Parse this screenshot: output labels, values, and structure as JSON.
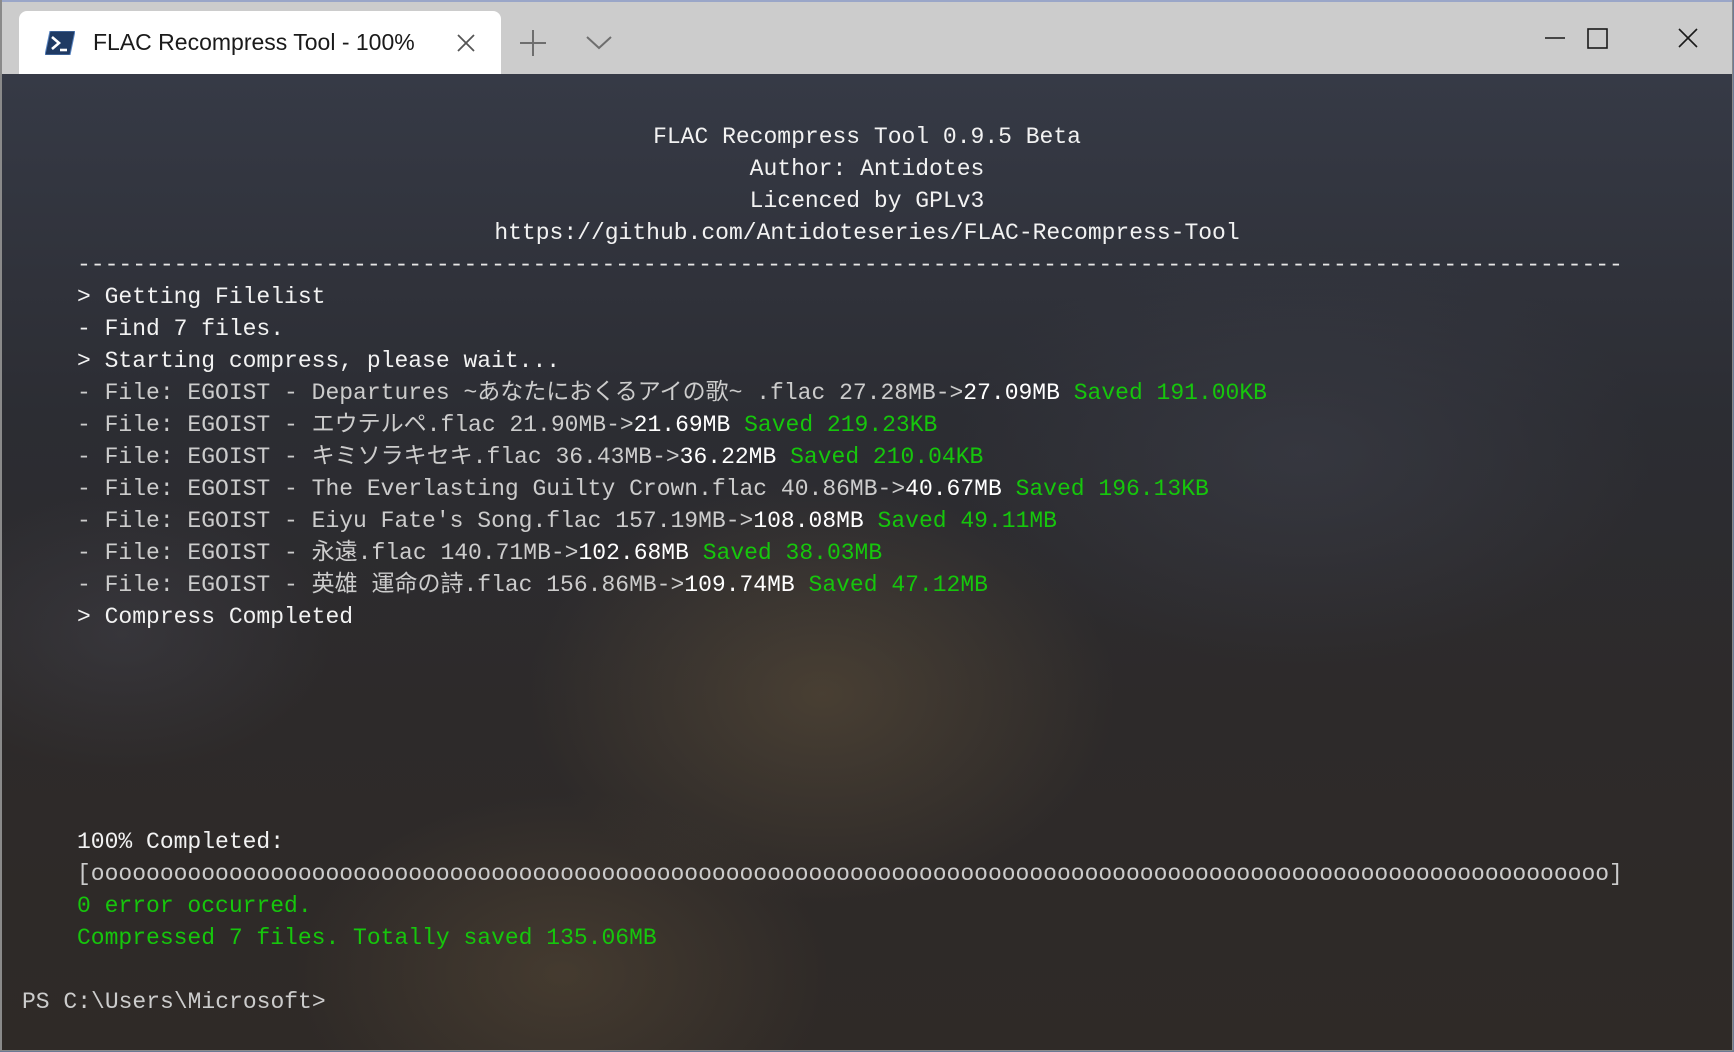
{
  "window": {
    "tab_title": "FLAC Recompress Tool - 100%",
    "tab_icon": "powershell-icon",
    "buttons": {
      "close_tab": "close-icon",
      "new_tab": "plus-icon",
      "dropdown": "chevron-down-icon",
      "minimize": "minimize-icon",
      "maximize": "maximize-icon",
      "close_window": "close-icon"
    }
  },
  "colors": {
    "text": "#cccccc",
    "bright_text": "#f2f2f2",
    "success_green": "#16c60c",
    "tab_bar": "#cccccc"
  },
  "header": {
    "title": "FLAC Recompress Tool 0.9.5 Beta",
    "author": "Author: Antidotes",
    "licence": "Licenced by GPLv3",
    "url": "https://github.com/Antidoteseries/FLAC-Recompress-Tool",
    "separator": "----------------------------------------------------------------------------------------------------------------"
  },
  "status": {
    "getting_filelist": "> Getting Filelist",
    "found_files": "- Find 7 files.",
    "starting": "> Starting compress, please wait...",
    "completed": "> Compress Completed"
  },
  "files": [
    {
      "prefix": "- File: EGOIST - Departures ~あなたにおくるアイの歌~ .flac 27.28MB->",
      "new_size": "27.09MB",
      "saved": "Saved 191.00KB"
    },
    {
      "prefix": "- File: EGOIST - エウテルペ.flac 21.90MB->",
      "new_size": "21.69MB",
      "saved": "Saved 219.23KB"
    },
    {
      "prefix": "- File: EGOIST - キミソラキセキ.flac 36.43MB->",
      "new_size": "36.22MB",
      "saved": "Saved 210.04KB"
    },
    {
      "prefix": "- File: EGOIST - The Everlasting Guilty Crown.flac 40.86MB->",
      "new_size": "40.67MB",
      "saved": "Saved 196.13KB"
    },
    {
      "prefix": "- File: EGOIST - Eiyu Fate's Song.flac 157.19MB->",
      "new_size": "108.08MB",
      "saved": "Saved 49.11MB"
    },
    {
      "prefix": "- File: EGOIST - 永遠.flac 140.71MB->",
      "new_size": "102.68MB",
      "saved": "Saved 38.03MB"
    },
    {
      "prefix": "- File: EGOIST - 英雄 運命の詩.flac 156.86MB->",
      "new_size": "109.74MB",
      "saved": "Saved 47.12MB"
    }
  ],
  "summary": {
    "progress_label": "100% Completed:",
    "progress_percent": 100,
    "progress_bar": "[oooooooooooooooooooooooooooooooooooooooooooooooooooooooooooooooooooooooooooooooooooooooooooooooooooooooooooooo]",
    "errors": "0 error occurred.",
    "total": "Compressed 7 files. Totally saved 135.06MB"
  },
  "prompt": "PS C:\\Users\\Microsoft>"
}
